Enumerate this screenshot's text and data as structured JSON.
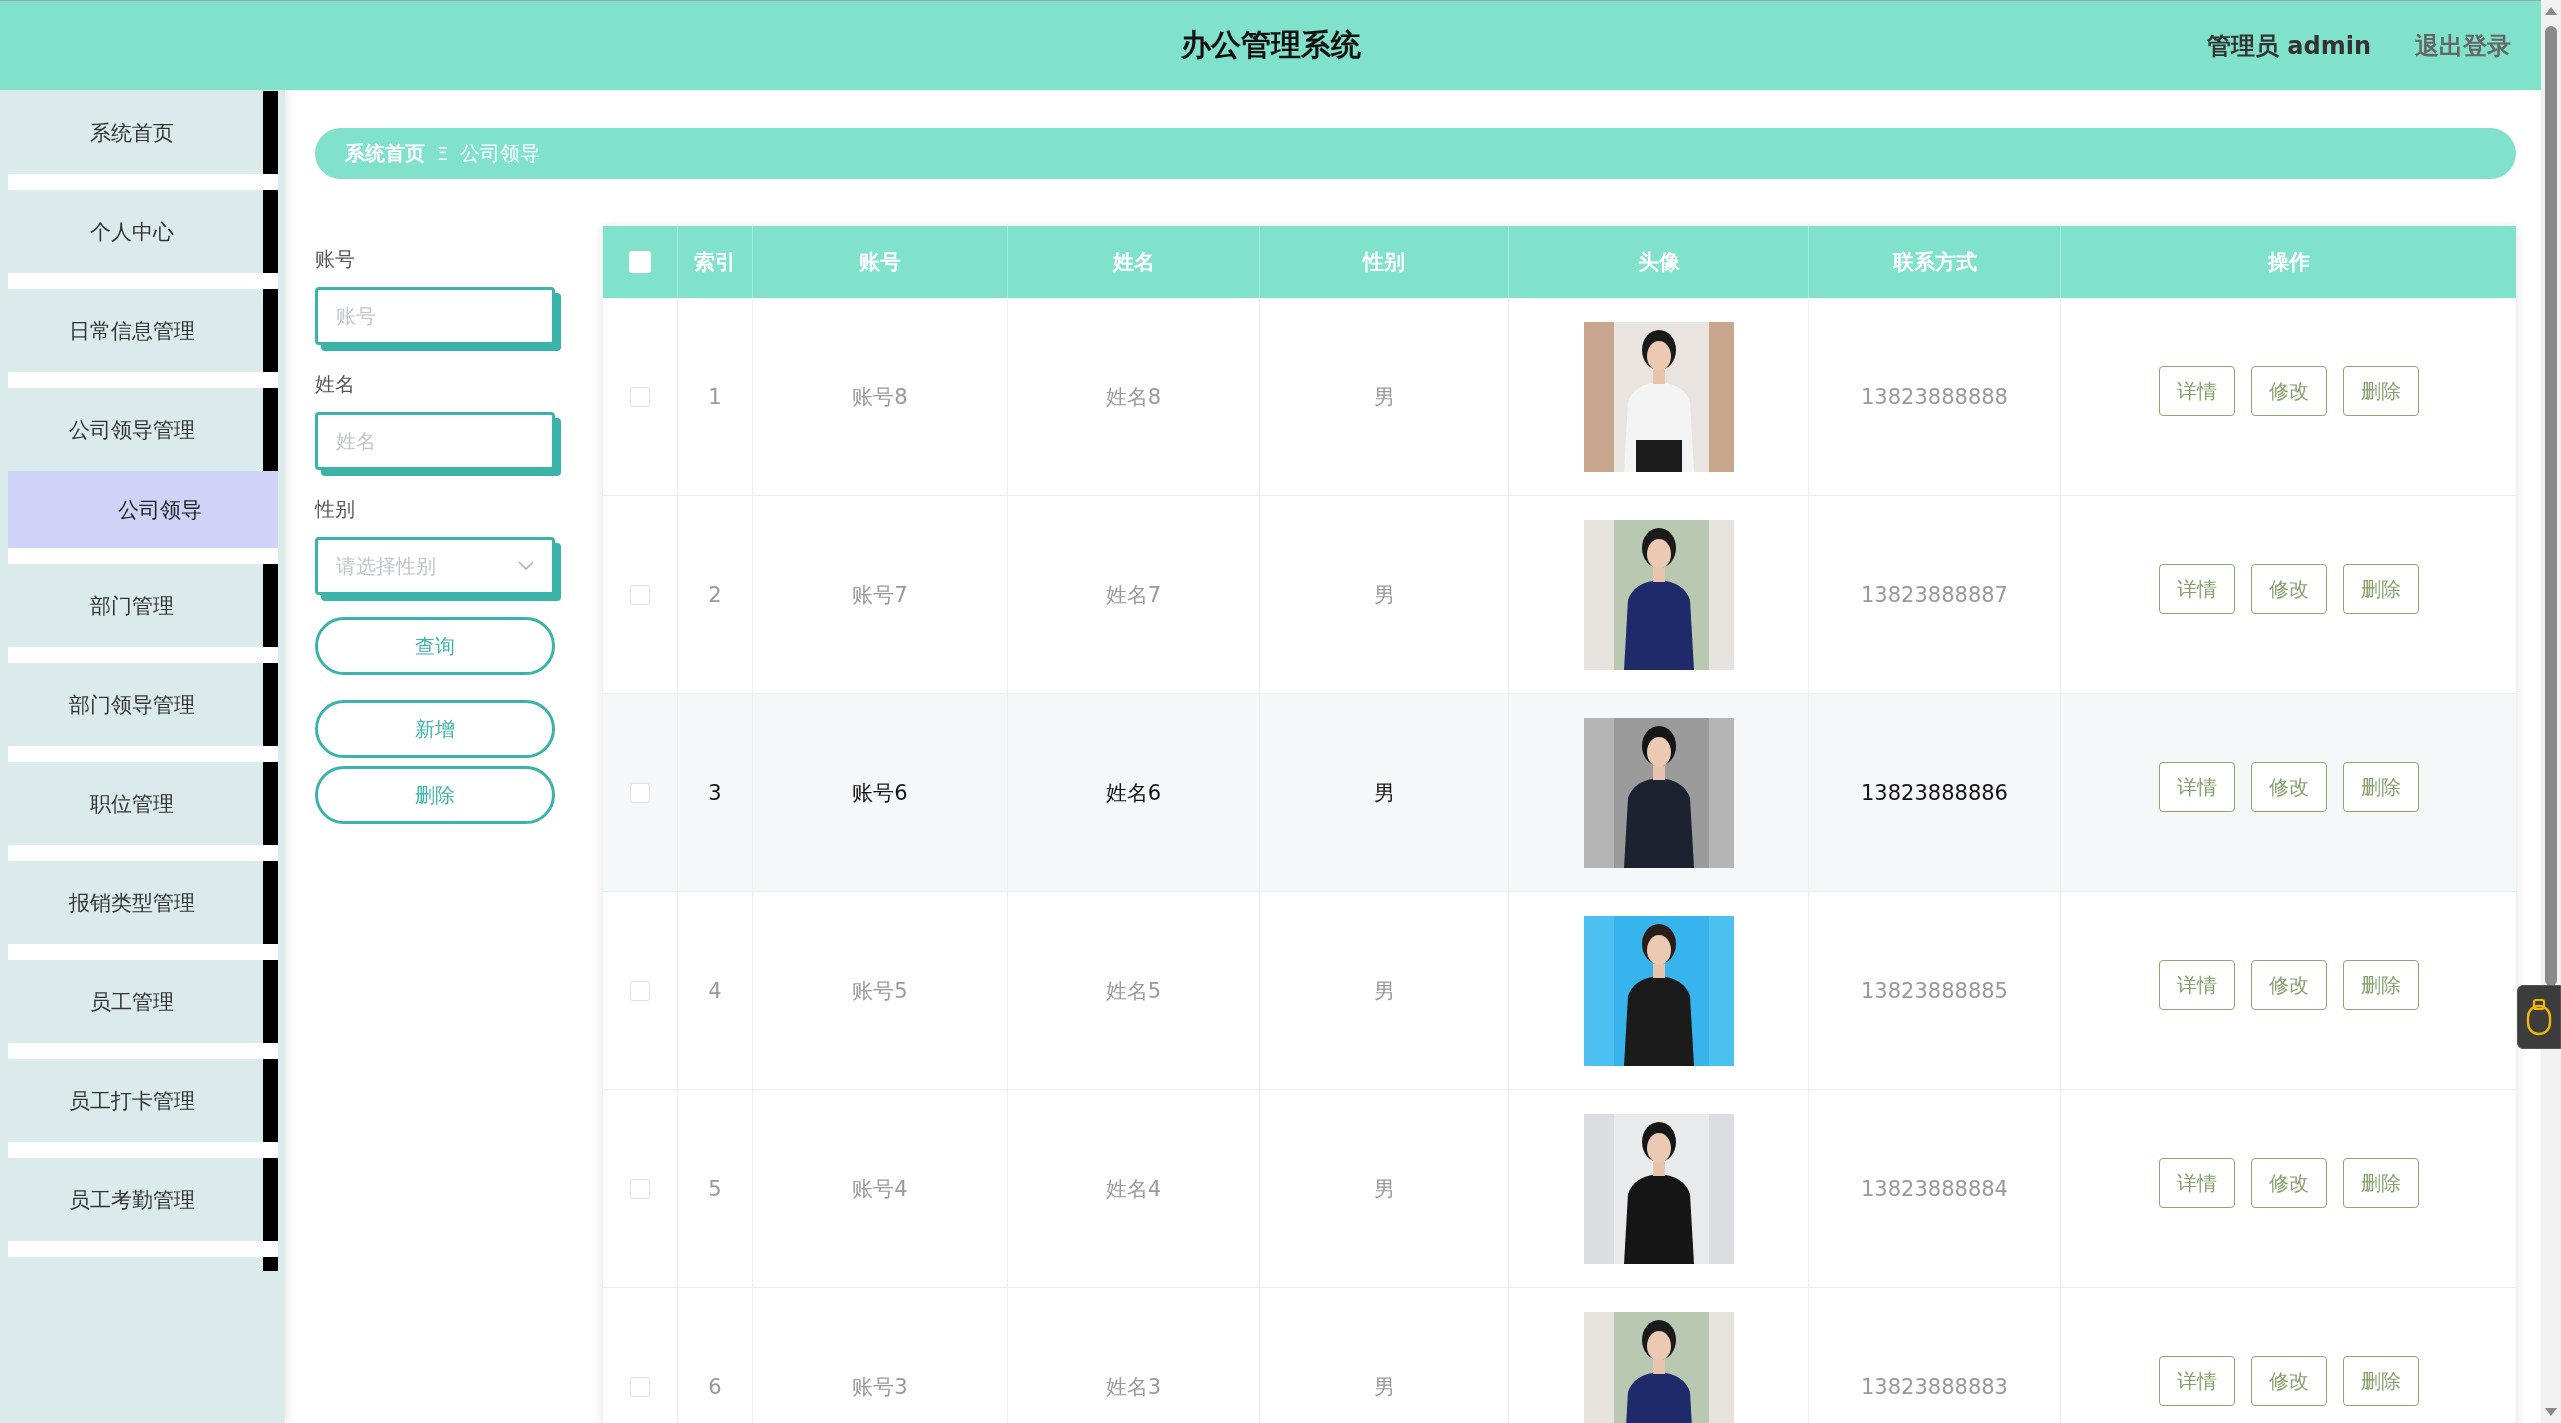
{
  "header": {
    "title": "办公管理系统",
    "user": "管理员 admin",
    "logout": "退出登录"
  },
  "sidebar": {
    "items": [
      {
        "label": "系统首页",
        "selected": false
      },
      {
        "label": "个人中心",
        "selected": false
      },
      {
        "label": "日常信息管理",
        "selected": false
      },
      {
        "label": "公司领导管理",
        "selected": false,
        "expanded": true,
        "children": [
          {
            "label": "公司领导",
            "selected": true
          }
        ]
      },
      {
        "label": "部门管理",
        "selected": false
      },
      {
        "label": "部门领导管理",
        "selected": false
      },
      {
        "label": "职位管理",
        "selected": false
      },
      {
        "label": "报销类型管理",
        "selected": false
      },
      {
        "label": "员工管理",
        "selected": false
      },
      {
        "label": "员工打卡管理",
        "selected": false
      },
      {
        "label": "员工考勤管理",
        "selected": false
      }
    ]
  },
  "breadcrumb": {
    "items": [
      "系统首页",
      "公司领导"
    ],
    "separator": "Ξ"
  },
  "search_form": {
    "fields": [
      {
        "kind": "input",
        "label": "账号",
        "placeholder": "账号"
      },
      {
        "kind": "input",
        "label": "姓名",
        "placeholder": "姓名"
      },
      {
        "kind": "select",
        "label": "性别",
        "placeholder": "请选择性别"
      }
    ],
    "buttons": [
      "查询",
      "新增",
      "删除"
    ]
  },
  "table": {
    "select_all_checked": false,
    "columns": [
      "索引",
      "账号",
      "姓名",
      "性别",
      "头像",
      "联系方式",
      "操作"
    ],
    "rows": [
      {
        "checked": false,
        "highlighted": false,
        "index": "1",
        "account": "账号8",
        "name": "姓名8",
        "gender": "男",
        "phone": "13823888888",
        "actions": [
          "详情",
          "修改",
          "删除"
        ]
      },
      {
        "checked": false,
        "highlighted": false,
        "index": "2",
        "account": "账号7",
        "name": "姓名7",
        "gender": "男",
        "phone": "13823888887",
        "actions": [
          "详情",
          "修改",
          "删除"
        ]
      },
      {
        "checked": false,
        "highlighted": true,
        "index": "3",
        "account": "账号6",
        "name": "姓名6",
        "gender": "男",
        "phone": "13823888886",
        "actions": [
          "详情",
          "修改",
          "删除"
        ]
      },
      {
        "checked": false,
        "highlighted": false,
        "index": "4",
        "account": "账号5",
        "name": "姓名5",
        "gender": "男",
        "phone": "13823888885",
        "actions": [
          "详情",
          "修改",
          "删除"
        ]
      },
      {
        "checked": false,
        "highlighted": false,
        "index": "5",
        "account": "账号4",
        "name": "姓名4",
        "gender": "男",
        "phone": "13823888884",
        "actions": [
          "详情",
          "修改",
          "删除"
        ]
      },
      {
        "checked": false,
        "highlighted": false,
        "index": "6",
        "account": "账号3",
        "name": "姓名3",
        "gender": "男",
        "phone": "13823888883",
        "actions": [
          "详情",
          "修改",
          "删除"
        ]
      }
    ]
  }
}
